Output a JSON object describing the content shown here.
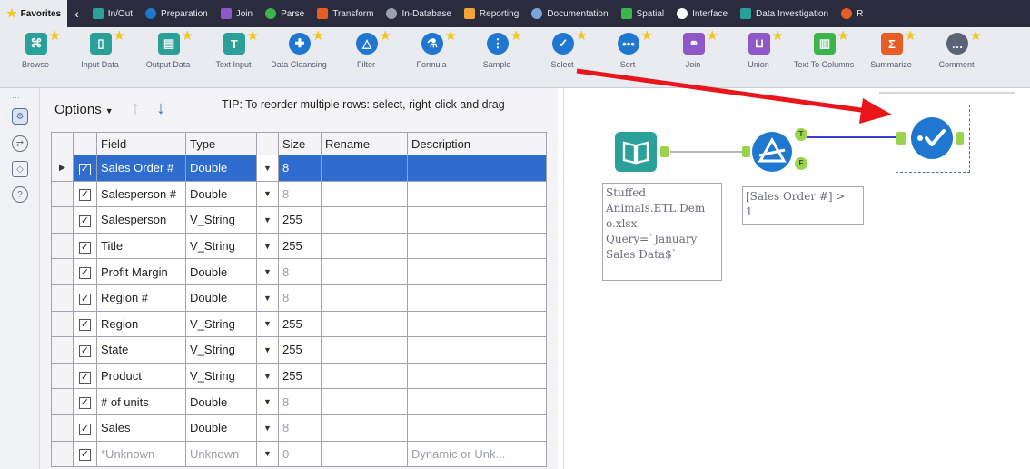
{
  "tabs": [
    {
      "label": "Favorites",
      "color": "#f5c518",
      "active": true
    },
    {
      "label": "In/Out",
      "color": "#2aa198"
    },
    {
      "label": "Preparation",
      "color": "#1f77d0"
    },
    {
      "label": "Join",
      "color": "#8e58c9"
    },
    {
      "label": "Parse",
      "color": "#3bb54a"
    },
    {
      "label": "Transform",
      "color": "#e85d25"
    },
    {
      "label": "In-Database",
      "color": "#9aa0ad"
    },
    {
      "label": "Reporting",
      "color": "#f2a23a"
    },
    {
      "label": "Documentation",
      "color": "#7aa5d8"
    },
    {
      "label": "Spatial",
      "color": "#39b54a"
    },
    {
      "label": "Interface",
      "color": "#ffffff"
    },
    {
      "label": "Data Investigation",
      "color": "#2aa198"
    },
    {
      "label": "R",
      "color": "#e85d25"
    }
  ],
  "tools": [
    {
      "label": "Browse",
      "icon": "binoculars-icon",
      "color": "#2aa198",
      "glyph": "⌘"
    },
    {
      "label": "Input Data",
      "icon": "book-open-icon",
      "color": "#2aa198",
      "glyph": "▯"
    },
    {
      "label": "Output Data",
      "icon": "book-write-icon",
      "color": "#2aa198",
      "glyph": "▤"
    },
    {
      "label": "Text Input",
      "icon": "text-book-icon",
      "color": "#2aa198",
      "glyph": "T"
    },
    {
      "label": "Data Cleansing",
      "icon": "cleanse-icon",
      "color": "#1f77d0",
      "glyph": "✚"
    },
    {
      "label": "Filter",
      "icon": "filter-triangle-icon",
      "color": "#1f77d0",
      "glyph": "△"
    },
    {
      "label": "Formula",
      "icon": "flask-icon",
      "color": "#1f77d0",
      "glyph": "⚗"
    },
    {
      "label": "Sample",
      "icon": "sample-icon",
      "color": "#1f77d0",
      "glyph": "⋮"
    },
    {
      "label": "Select",
      "icon": "checkmark-icon",
      "color": "#1f77d0",
      "glyph": "✓"
    },
    {
      "label": "Sort",
      "icon": "dots-icon",
      "color": "#1f77d0",
      "glyph": "•••"
    },
    {
      "label": "Join",
      "icon": "join-icon",
      "color": "#8e58c9",
      "glyph": "⚭"
    },
    {
      "label": "Union",
      "icon": "union-icon",
      "color": "#8e58c9",
      "glyph": "⊔"
    },
    {
      "label": "Text To Columns",
      "icon": "text-columns-icon",
      "color": "#3bb54a",
      "glyph": "▥"
    },
    {
      "label": "Summarize",
      "icon": "sigma-icon",
      "color": "#e85d25",
      "glyph": "Σ"
    },
    {
      "label": "Comment",
      "icon": "speech-bubble-icon",
      "color": "#5a6275",
      "glyph": "…"
    }
  ],
  "options": {
    "label": "Options"
  },
  "tip": "TIP: To reorder multiple rows: select, right-click and drag",
  "columns": [
    "Field",
    "Type",
    "Size",
    "Rename",
    "Description"
  ],
  "rows": [
    {
      "field": "Sales Order #",
      "type": "Double",
      "size": "8",
      "rename": "",
      "description": "",
      "checked": true,
      "selected": true,
      "dim_size": false
    },
    {
      "field": "Salesperson #",
      "type": "Double",
      "size": "8",
      "rename": "",
      "description": "",
      "checked": true,
      "dim_size": true
    },
    {
      "field": "Salesperson",
      "type": "V_String",
      "size": "255",
      "rename": "",
      "description": "",
      "checked": true,
      "dim_size": false
    },
    {
      "field": "Title",
      "type": "V_String",
      "size": "255",
      "rename": "",
      "description": "",
      "checked": true,
      "dim_size": false
    },
    {
      "field": "Profit Margin",
      "type": "Double",
      "size": "8",
      "rename": "",
      "description": "",
      "checked": true,
      "dim_size": true
    },
    {
      "field": "Region #",
      "type": "Double",
      "size": "8",
      "rename": "",
      "description": "",
      "checked": true,
      "dim_size": true
    },
    {
      "field": "Region",
      "type": "V_String",
      "size": "255",
      "rename": "",
      "description": "",
      "checked": true,
      "dim_size": false
    },
    {
      "field": "State",
      "type": "V_String",
      "size": "255",
      "rename": "",
      "description": "",
      "checked": true,
      "dim_size": false
    },
    {
      "field": "Product",
      "type": "V_String",
      "size": "255",
      "rename": "",
      "description": "",
      "checked": true,
      "dim_size": false
    },
    {
      "field": "# of units",
      "type": "Double",
      "size": "8",
      "rename": "",
      "description": "",
      "checked": true,
      "dim_size": true
    },
    {
      "field": "Sales",
      "type": "Double",
      "size": "8",
      "rename": "",
      "description": "",
      "checked": true,
      "dim_size": true
    },
    {
      "field": "*Unknown",
      "type": "Unknown",
      "size": "0",
      "rename": "",
      "description": "Dynamic or Unk...",
      "checked": true,
      "dim_all": true
    }
  ],
  "canvas": {
    "input_annotation": [
      "Stuffed",
      "Animals.ETL.Dem",
      "o.xlsx",
      "Query=`January",
      "Sales Data$`"
    ],
    "filter_annotation": [
      "[Sales Order #] >",
      "1"
    ],
    "filter_true": "T",
    "filter_false": "F"
  },
  "colors": {
    "selected_row": "#2e6ccf",
    "arrow": "#e8161b",
    "connector": "#9bd34d",
    "link": "#3a3fcf",
    "tool_blue": "#1f77d0",
    "tool_teal": "#2aa198"
  }
}
